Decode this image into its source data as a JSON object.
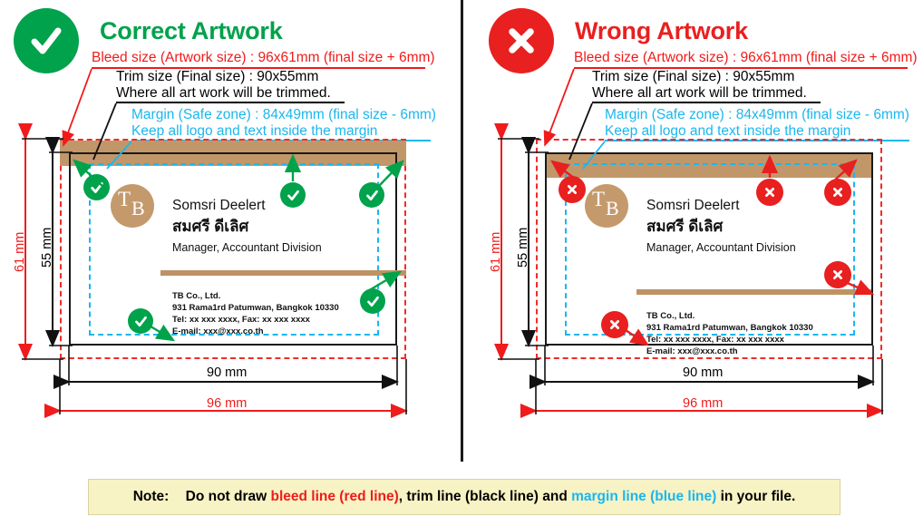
{
  "panels": [
    {
      "id": "correct",
      "status": "correct",
      "badge_icon": "check-circle-icon",
      "title": "Correct Artwork",
      "accent": "#00a24b",
      "annotations": {
        "bleed": "Bleed size (Artwork size) : 96x61mm (final size + 6mm)",
        "trim_1": "Trim size (Final size) : 90x55mm",
        "trim_2": "Where all art work will be trimmed.",
        "margin_1": "Margin (Safe zone) : 84x49mm (final size - 6mm)",
        "margin_2": "Keep all logo and text inside the margin"
      },
      "dimensions": {
        "height_bleed": "61 mm",
        "height_trim": "55 mm",
        "width_trim": "90 mm",
        "width_bleed": "96 mm"
      },
      "card": {
        "logo_top": "T",
        "logo_bottom": "B",
        "name": "Somsri Deelert",
        "name_thai": "สมศรี ดีเลิศ",
        "role": "Manager, Accountant Division",
        "company": "TB Co., Ltd.",
        "address": "931 Rama1rd Patumwan, Bangkok 10330",
        "phone": "Tel: xx xxx xxxx,  Fax: xx xxx xxxx",
        "email": "E-mail: xxx@xxx.co.th"
      },
      "marker_count": 5
    },
    {
      "id": "wrong",
      "status": "wrong",
      "badge_icon": "x-circle-icon",
      "title": "Wrong Artwork",
      "accent": "#e8201f",
      "annotations": {
        "bleed": "Bleed size (Artwork size) : 96x61mm (final size + 6mm)",
        "trim_1": "Trim size (Final size) : 90x55mm",
        "trim_2": "Where all art work will be trimmed.",
        "margin_1": "Margin (Safe zone) : 84x49mm   (final size - 6mm)",
        "margin_2": "Keep all logo and text inside the margin"
      },
      "dimensions": {
        "height_bleed": "61 mm",
        "height_trim": "55 mm",
        "width_trim": "90 mm",
        "width_bleed": "96 mm"
      },
      "card": {
        "logo_top": "T",
        "logo_bottom": "B",
        "name": "Somsri Deelert",
        "name_thai": "สมศรี ดีเลิศ",
        "role": "Manager, Accountant Division",
        "company": "TB Co., Ltd.",
        "address": "931 Rama1rd Patumwan, Bangkok 10330",
        "phone": "Tel: xx xxx xxxx,  Fax: xx xxx xxxx",
        "email": "E-mail: xxx@xxx.co.th"
      },
      "marker_count": 5
    }
  ],
  "note": {
    "label": "Note:",
    "part1": "Do not draw ",
    "red": "bleed line (red line)",
    "part2": ", trim line (black line) and ",
    "blue": "margin line (blue line)",
    "part3": " in your file."
  },
  "colors": {
    "bleed_line": "#f22b2b",
    "trim_line": "#1a1a1a",
    "margin_line": "#1ab7ef",
    "brand_brown": "#c49a6c",
    "correct_green": "#00a24b",
    "wrong_red": "#e8201f",
    "note_bg": "#f8f3c4"
  }
}
